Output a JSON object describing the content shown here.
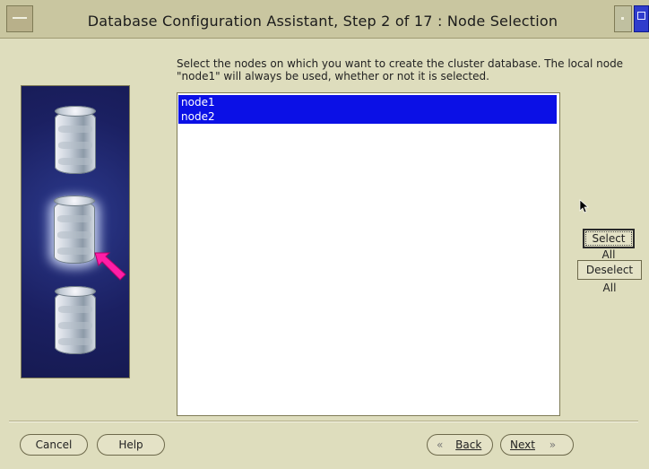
{
  "window": {
    "title": "Database Configuration Assistant, Step 2 of 17 : Node Selection"
  },
  "main": {
    "instructions": "Select the nodes on which you want to create the cluster database. The local node \"node1\" will always be used, whether or not it is selected.",
    "nodes": [
      {
        "label": "node1",
        "selected": true
      },
      {
        "label": "node2",
        "selected": true
      }
    ]
  },
  "side_buttons": {
    "select_all": "Select All",
    "deselect_all": "Deselect All"
  },
  "footer": {
    "cancel": "Cancel",
    "help": "Help",
    "back": "Back",
    "next": "Next"
  },
  "colors": {
    "selection": "#0b10e6",
    "background": "#deddbd",
    "titlebar": "#c9c6a0",
    "accent_arrow": "#ff1ea6"
  }
}
